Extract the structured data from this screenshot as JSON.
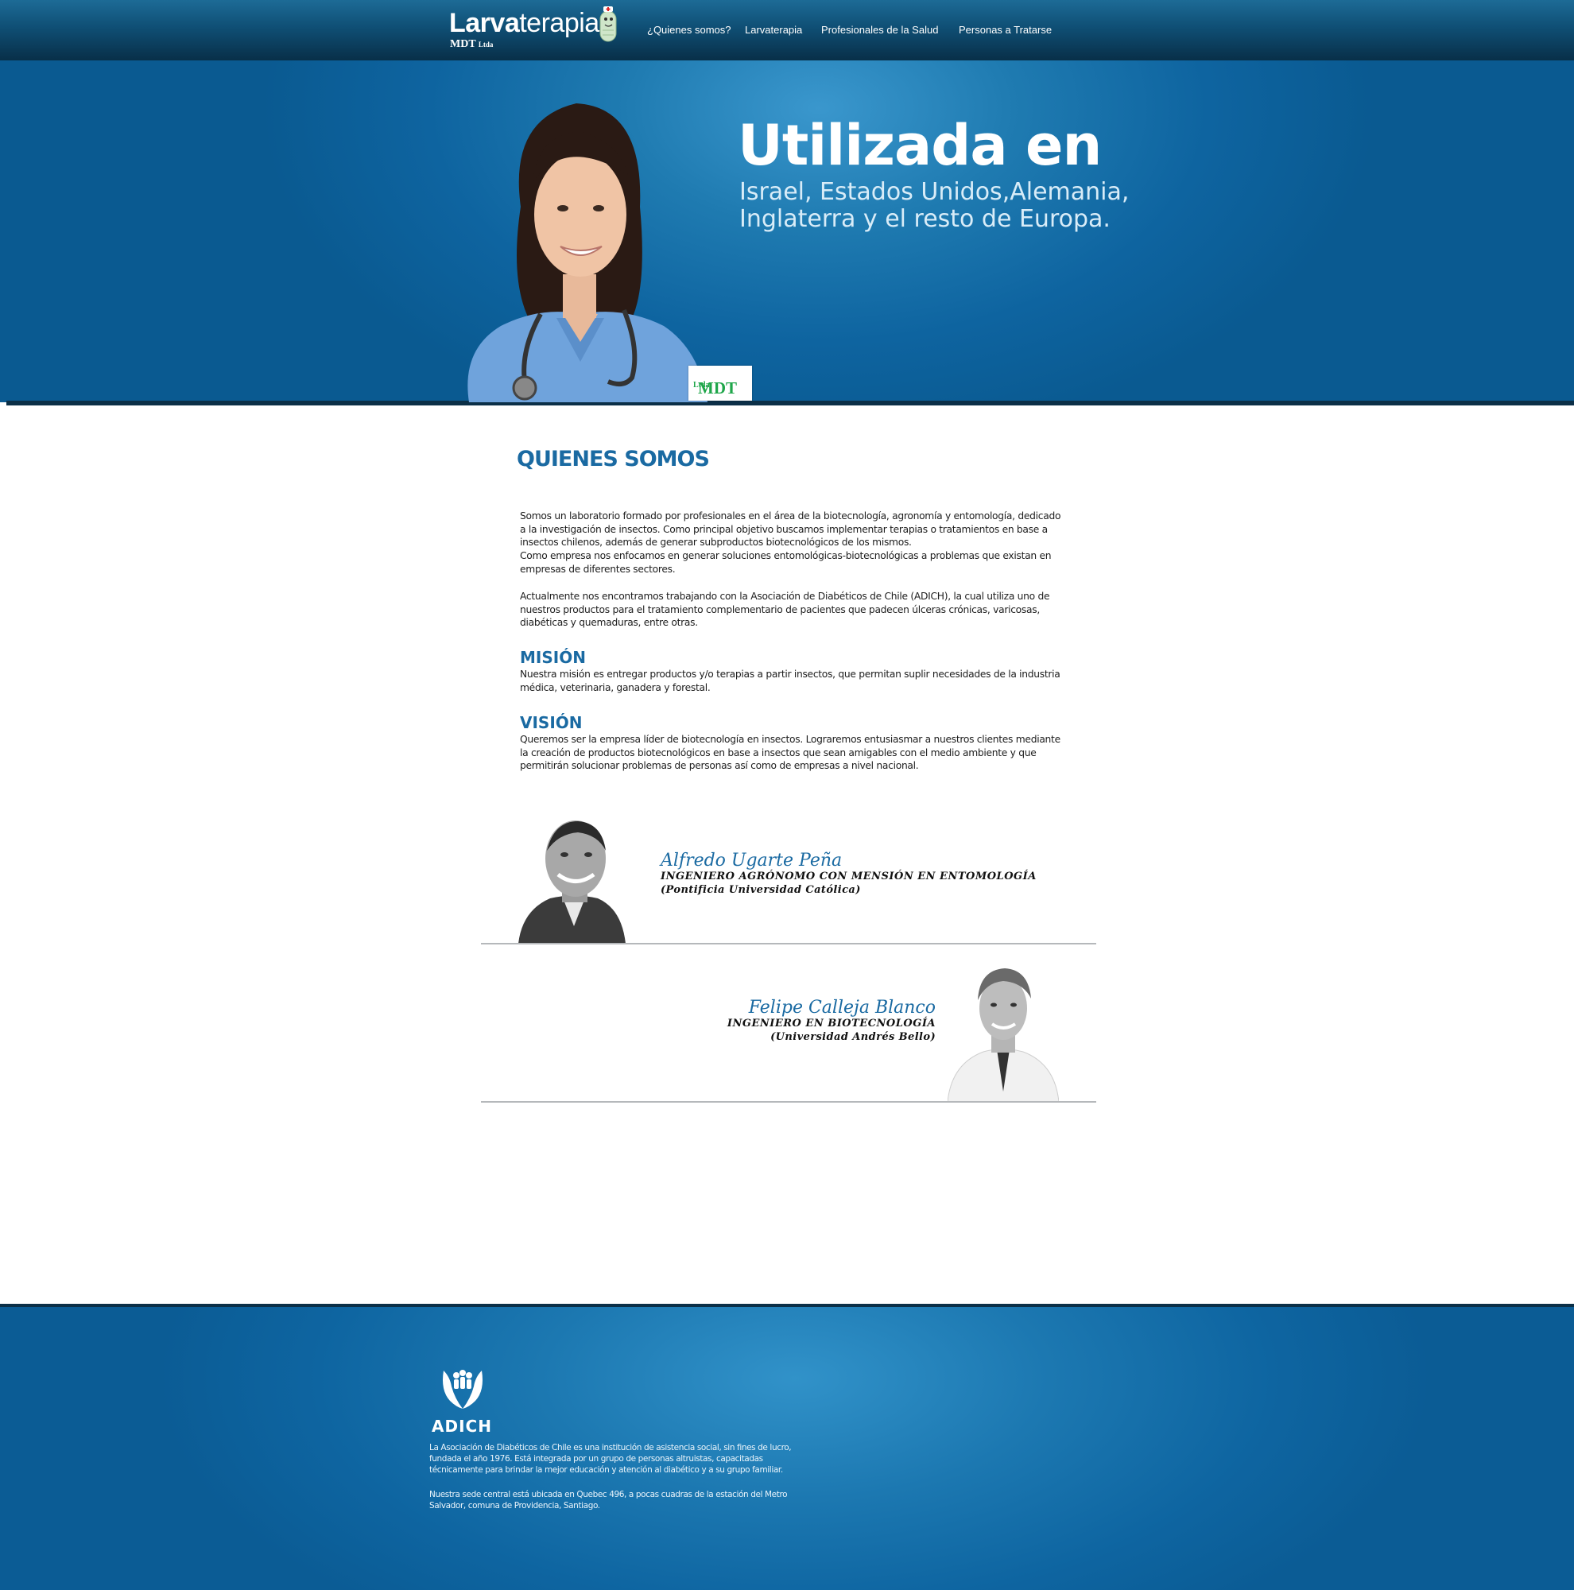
{
  "nav": {
    "logo_bold": "Larva",
    "logo_rest": "terapia",
    "logo_sub": "MDT",
    "logo_sub_small": "Ltda",
    "links": [
      "¿Quienes somos?",
      "Larvaterapia",
      "Profesionales de la Salud",
      "Personas a Tratarse"
    ]
  },
  "hero": {
    "title": "Utilizada en",
    "subtitle_line1": "Israel, Estados Unidos,Alemania,",
    "subtitle_line2": "Inglaterra y el resto de Europa.",
    "badge": "MDT",
    "badge_small": "Ltda"
  },
  "about": {
    "title": "QUIENES SOMOS",
    "paragraph1": "Somos un laboratorio formado por profesionales en el área de la biotecnología, agronomía y entomología, dedicado a la investigación de insectos. Como principal objetivo buscamos implementar terapias o tratamientos en base a insectos chilenos, además de generar subproductos biotecnológicos de los mismos.",
    "paragraph2": "Como empresa nos enfocamos en generar soluciones entomológicas-biotecnológicas a problemas que existan en empresas de diferentes sectores.",
    "paragraph3": "Actualmente nos encontramos trabajando con la Asociación de Diabéticos de Chile (ADICH), la cual utiliza uno de nuestros productos para el tratamiento complementario de pacientes que padecen úlceras crónicas, varicosas, diabéticas y quemaduras, entre otras.",
    "mision_title": "MISIÓN",
    "mision_text": "Nuestra misión es entregar productos y/o terapias a partir insectos, que permitan suplir necesidades de la industria médica, veterinaria, ganadera y forestal.",
    "vision_title": "VISIÓN",
    "vision_text": "Queremos ser la empresa líder de biotecnología en insectos. Lograremos entusiasmar a nuestros clientes mediante la creación de productos biotecnológicos en base a insectos que sean amigables con el medio ambiente y que permitirán solucionar problemas de personas así como de empresas a nivel nacional."
  },
  "team": [
    {
      "name": "Alfredo Ugarte Peña",
      "title": "INGENIERO AGRÓNOMO CON MENSIÓN EN ENTOMOLOGÍA",
      "university": "(Pontificia Universidad Católica)"
    },
    {
      "name": "Felipe Calleja Blanco",
      "title": "INGENIERO EN BIOTECNOLOGÍA",
      "university": "(Universidad Andrés Bello)"
    }
  ],
  "footer": {
    "org_name": "ADICH",
    "text1": "La Asociación de Diabéticos de Chile es una institución de asistencia social, sin fines de lucro, fundada el año 1976. Está integrada por un grupo de personas altruistas, capacitadas técnicamente para brindar la mejor educación y atención al diabético y a su grupo familiar.",
    "text2": "Nuestra sede central está ubicada en Quebec 496, a pocas cuadras de la estación del Metro Salvador, comuna de Providencia, Santiago."
  },
  "colors": {
    "brand_blue": "#1a6aa2",
    "hero_blue": "#1f7bb1",
    "nav_dark": "#0f4f75",
    "badge_green": "#1fa64a"
  },
  "icons": [
    "larva-mascot-icon",
    "adich-hands-icon"
  ]
}
